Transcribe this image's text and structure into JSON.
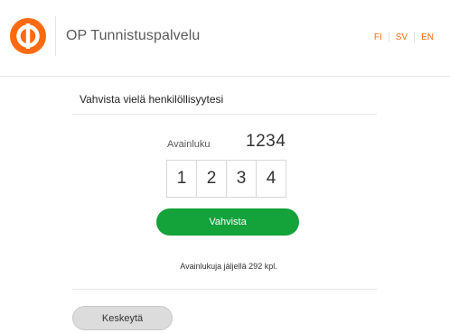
{
  "header": {
    "title": "OP Tunnistuspalvelu",
    "languages": [
      {
        "label": "FI"
      },
      {
        "label": "SV"
      },
      {
        "label": "EN"
      }
    ],
    "brand_color": "#ff6a10",
    "logo_icon": "op-logo-icon"
  },
  "main": {
    "heading": "Vahvista vielä henkilöllisyytesi",
    "key_label": "Avainluku",
    "key_number": "1234",
    "digits": [
      "1",
      "2",
      "3",
      "4"
    ],
    "confirm_label": "Vahvista",
    "confirm_color": "#14a23a",
    "remaining_text": "Avainlukuja jäljellä 292 kpl.",
    "cancel_label": "Keskeytä"
  }
}
